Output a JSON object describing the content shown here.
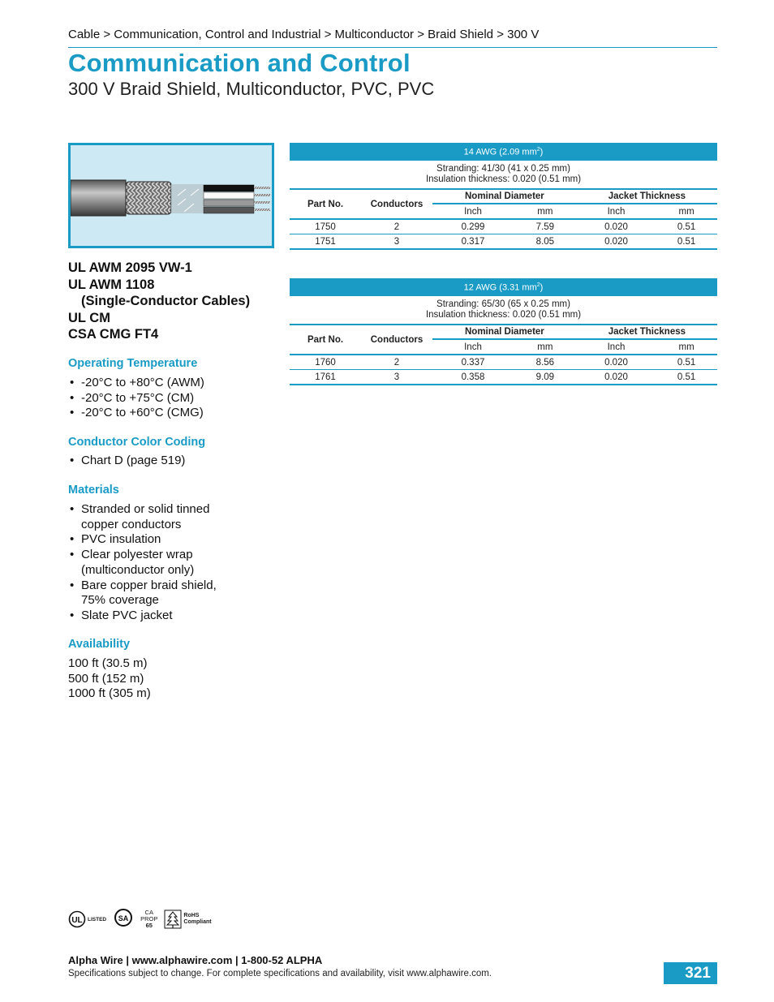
{
  "breadcrumb": "Cable > Communication, Control and Industrial > Multiconductor > Braid Shield > 300 V",
  "title": "Communication and Control",
  "subtitle": "300 V Braid Shield, Multiconductor, PVC, PVC",
  "product_image": "cable-cutaway-illustration",
  "certifications": [
    "UL AWM 2095 VW-1",
    "UL AWM 1108",
    "(Single-Conductor Cables)",
    "UL CM",
    "CSA CMG FT4"
  ],
  "sections": {
    "operating_temperature": {
      "heading": "Operating Temperature",
      "items": [
        "-20°C to +80°C (AWM)",
        "-20°C to +75°C (CM)",
        "-20°C to +60°C (CMG)"
      ]
    },
    "color_coding": {
      "heading": "Conductor Color Coding",
      "items": [
        "Chart D (page 519)"
      ]
    },
    "materials": {
      "heading": "Materials",
      "items": [
        "Stranded or solid tinned copper conductors",
        "PVC insulation",
        "Clear polyester wrap (multiconductor only)",
        "Bare copper braid shield, 75% coverage",
        "Slate PVC jacket"
      ]
    },
    "availability": {
      "heading": "Availability",
      "items": [
        "100 ft (30.5 m)",
        "500 ft (152 m)",
        "1000 ft (305 m)"
      ]
    }
  },
  "table_headers": {
    "part_no": "Part No.",
    "conductors": "Conductors",
    "nominal_diameter": "Nominal Diameter",
    "jacket_thickness": "Jacket Thickness",
    "inch": "Inch",
    "mm": "mm"
  },
  "tables": [
    {
      "gauge": "14 AWG (2.09 mm",
      "gauge_sup": "2",
      "gauge_close": ")",
      "stranding": "Stranding: 41/30 (41 x 0.25 mm)",
      "insulation": "Insulation thickness: 0.020 (0.51 mm)",
      "rows": [
        {
          "part": "1750",
          "conductors": "2",
          "dia_in": "0.299",
          "dia_mm": "7.59",
          "jt_in": "0.020",
          "jt_mm": "0.51"
        },
        {
          "part": "1751",
          "conductors": "3",
          "dia_in": "0.317",
          "dia_mm": "8.05",
          "jt_in": "0.020",
          "jt_mm": "0.51"
        }
      ]
    },
    {
      "gauge": "12 AWG (3.31 mm",
      "gauge_sup": "2",
      "gauge_close": ")",
      "stranding": "Stranding: 65/30 (65 x 0.25 mm)",
      "insulation": "Insulation thickness: 0.020 (0.51 mm)",
      "rows": [
        {
          "part": "1760",
          "conductors": "2",
          "dia_in": "0.337",
          "dia_mm": "8.56",
          "jt_in": "0.020",
          "jt_mm": "0.51"
        },
        {
          "part": "1761",
          "conductors": "3",
          "dia_in": "0.358",
          "dia_mm": "9.09",
          "jt_in": "0.020",
          "jt_mm": "0.51"
        }
      ]
    }
  ],
  "logos": {
    "ul_listed": "LISTED",
    "csa": "SA",
    "prop65_line1": "CA",
    "prop65_line2": "PROP",
    "prop65_line3": "65",
    "rohs_line1": "RoHS",
    "rohs_line2": "Compliant"
  },
  "footer": {
    "contact": "Alpha Wire | www.alphawire.com | 1-800-52 ALPHA",
    "disclaimer": "Specifications subject to change. For complete specifications and availability, visit www.alphawire.com.",
    "page_number": "321"
  },
  "colors": {
    "accent": "#1a9bc6",
    "image_bg": "#cdeaf4"
  }
}
